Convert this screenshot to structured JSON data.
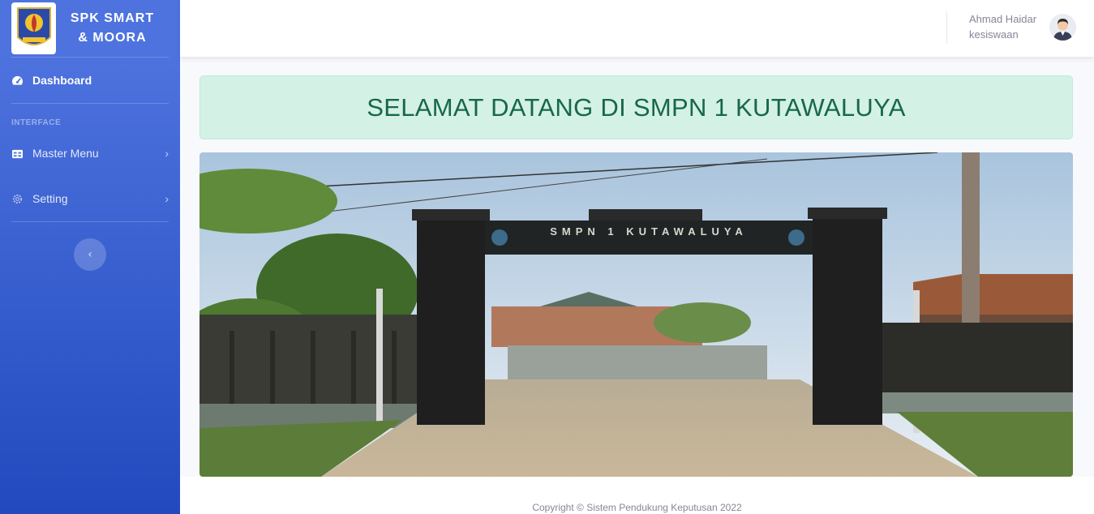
{
  "brand": {
    "title_line1": "SPK SMART",
    "title_line2": "& MOORA",
    "logo": "school-emblem"
  },
  "sidebar": {
    "dashboard": {
      "label": "Dashboard",
      "icon": "tachometer-icon"
    },
    "heading": "INTERFACE",
    "items": [
      {
        "label": "Master Menu",
        "icon": "table-icon",
        "chevron": "›"
      },
      {
        "label": "Setting",
        "icon": "gear-icon",
        "chevron": "›"
      }
    ],
    "toggle_icon": "‹"
  },
  "user": {
    "name": "Ahmad Haidar",
    "role": "kesiswaan"
  },
  "main": {
    "welcome": "SELAMAT DATANG DI SMPN 1 KUTAWALUYA",
    "gate_sign": "SMPN 1 KUTAWALUYA"
  },
  "footer": {
    "copyright": "Copyright © Sistem Pendukung Keputusan 2022"
  },
  "colors": {
    "sidebar_top": "#4e73df",
    "sidebar_bottom": "#224abe",
    "alert_bg": "#d4f1e6",
    "alert_text": "#17684a"
  }
}
